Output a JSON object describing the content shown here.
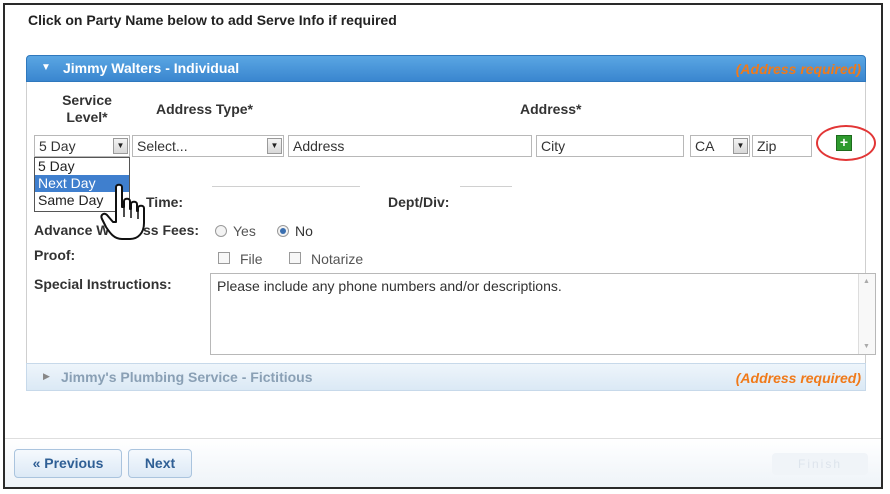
{
  "instruction": "Click on Party Name below to add Serve Info if required",
  "party1": {
    "name": "Jimmy Walters - Individual",
    "address_required": "(Address required)",
    "headers": {
      "service_level": "Service Level*",
      "address_type": "Address Type*",
      "address": "Address*"
    },
    "service_level_value": "5 Day",
    "service_level_options": [
      "5 Day",
      "Next Day",
      "Same Day"
    ],
    "service_level_highlighted": "Next Day",
    "address_type_value": "Select...",
    "address_placeholder": "Address",
    "city_placeholder": "City",
    "state_value": "CA",
    "zip_placeholder": "Zip",
    "time_label": "Time:",
    "dept_label": "Dept/Div:",
    "advance_fees_label": "Advance W",
    "advance_fees_label_tail": "ss Fees:",
    "yes_label": "Yes",
    "no_label": "No",
    "advance_fees_selected": "No",
    "proof_label": "Proof:",
    "file_label": "File",
    "notarize_label": "Notarize",
    "special_instructions_label": "Special Instructions:",
    "special_instructions_text": "Please include any phone numbers and/or descriptions."
  },
  "party2": {
    "name": "Jimmy's Plumbing Service - Fictitious",
    "address_required": "(Address required)"
  },
  "footer": {
    "previous_label": "« Previous",
    "next_label": "Next",
    "faint_label": "Finish"
  },
  "colors": {
    "header_blue": "#3a86cf",
    "address_required_orange": "#f07a1a",
    "annotation_red": "#e23636",
    "add_button_green": "#2e9a2e"
  }
}
